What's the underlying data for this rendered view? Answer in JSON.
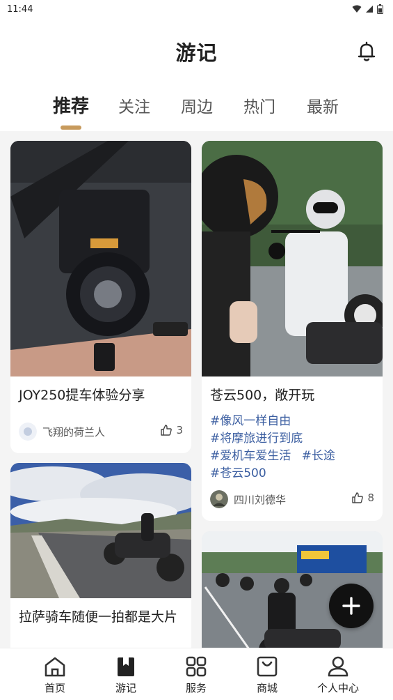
{
  "status_bar": {
    "time": "11:44"
  },
  "header": {
    "title": "游记"
  },
  "tabs": [
    {
      "label": "推荐",
      "active": true
    },
    {
      "label": "关注"
    },
    {
      "label": "周边"
    },
    {
      "label": "热门"
    },
    {
      "label": "最新"
    }
  ],
  "feed": {
    "left": [
      {
        "title": "JOY250提车体验分享",
        "author": "飞翔的荷兰人",
        "likes": "3"
      },
      {
        "title": "拉萨骑车随便一拍都是大片"
      }
    ],
    "right": [
      {
        "title": "苍云500，敞开玩",
        "tags": [
          "#像风一样自由",
          "#将摩旅进行到底",
          "#爱机车爱生活",
          "#长途",
          "#苍云500"
        ],
        "author": "四川刘德华",
        "likes": "8"
      },
      {}
    ]
  },
  "bottom_nav": [
    {
      "label": "首页",
      "icon": "home-icon"
    },
    {
      "label": "游记",
      "icon": "bookmark-icon",
      "active": true
    },
    {
      "label": "服务",
      "icon": "grid-icon"
    },
    {
      "label": "商城",
      "icon": "shopping-bag-icon"
    },
    {
      "label": "个人中心",
      "icon": "user-icon"
    }
  ],
  "colors": {
    "accent": "#c79a5c",
    "tag": "#3a5da0",
    "background": "#f4f4f4"
  }
}
